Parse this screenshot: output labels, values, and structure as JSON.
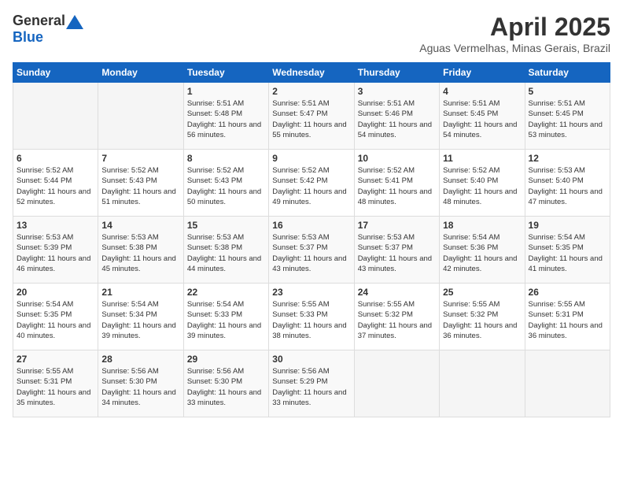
{
  "header": {
    "logo_general": "General",
    "logo_blue": "Blue",
    "title": "April 2025",
    "subtitle": "Aguas Vermelhas, Minas Gerais, Brazil"
  },
  "days_of_week": [
    "Sunday",
    "Monday",
    "Tuesday",
    "Wednesday",
    "Thursday",
    "Friday",
    "Saturday"
  ],
  "weeks": [
    [
      {
        "day": "",
        "info": ""
      },
      {
        "day": "",
        "info": ""
      },
      {
        "day": "1",
        "info": "Sunrise: 5:51 AM\nSunset: 5:48 PM\nDaylight: 11 hours and 56 minutes."
      },
      {
        "day": "2",
        "info": "Sunrise: 5:51 AM\nSunset: 5:47 PM\nDaylight: 11 hours and 55 minutes."
      },
      {
        "day": "3",
        "info": "Sunrise: 5:51 AM\nSunset: 5:46 PM\nDaylight: 11 hours and 54 minutes."
      },
      {
        "day": "4",
        "info": "Sunrise: 5:51 AM\nSunset: 5:45 PM\nDaylight: 11 hours and 54 minutes."
      },
      {
        "day": "5",
        "info": "Sunrise: 5:51 AM\nSunset: 5:45 PM\nDaylight: 11 hours and 53 minutes."
      }
    ],
    [
      {
        "day": "6",
        "info": "Sunrise: 5:52 AM\nSunset: 5:44 PM\nDaylight: 11 hours and 52 minutes."
      },
      {
        "day": "7",
        "info": "Sunrise: 5:52 AM\nSunset: 5:43 PM\nDaylight: 11 hours and 51 minutes."
      },
      {
        "day": "8",
        "info": "Sunrise: 5:52 AM\nSunset: 5:43 PM\nDaylight: 11 hours and 50 minutes."
      },
      {
        "day": "9",
        "info": "Sunrise: 5:52 AM\nSunset: 5:42 PM\nDaylight: 11 hours and 49 minutes."
      },
      {
        "day": "10",
        "info": "Sunrise: 5:52 AM\nSunset: 5:41 PM\nDaylight: 11 hours and 48 minutes."
      },
      {
        "day": "11",
        "info": "Sunrise: 5:52 AM\nSunset: 5:40 PM\nDaylight: 11 hours and 48 minutes."
      },
      {
        "day": "12",
        "info": "Sunrise: 5:53 AM\nSunset: 5:40 PM\nDaylight: 11 hours and 47 minutes."
      }
    ],
    [
      {
        "day": "13",
        "info": "Sunrise: 5:53 AM\nSunset: 5:39 PM\nDaylight: 11 hours and 46 minutes."
      },
      {
        "day": "14",
        "info": "Sunrise: 5:53 AM\nSunset: 5:38 PM\nDaylight: 11 hours and 45 minutes."
      },
      {
        "day": "15",
        "info": "Sunrise: 5:53 AM\nSunset: 5:38 PM\nDaylight: 11 hours and 44 minutes."
      },
      {
        "day": "16",
        "info": "Sunrise: 5:53 AM\nSunset: 5:37 PM\nDaylight: 11 hours and 43 minutes."
      },
      {
        "day": "17",
        "info": "Sunrise: 5:53 AM\nSunset: 5:37 PM\nDaylight: 11 hours and 43 minutes."
      },
      {
        "day": "18",
        "info": "Sunrise: 5:54 AM\nSunset: 5:36 PM\nDaylight: 11 hours and 42 minutes."
      },
      {
        "day": "19",
        "info": "Sunrise: 5:54 AM\nSunset: 5:35 PM\nDaylight: 11 hours and 41 minutes."
      }
    ],
    [
      {
        "day": "20",
        "info": "Sunrise: 5:54 AM\nSunset: 5:35 PM\nDaylight: 11 hours and 40 minutes."
      },
      {
        "day": "21",
        "info": "Sunrise: 5:54 AM\nSunset: 5:34 PM\nDaylight: 11 hours and 39 minutes."
      },
      {
        "day": "22",
        "info": "Sunrise: 5:54 AM\nSunset: 5:33 PM\nDaylight: 11 hours and 39 minutes."
      },
      {
        "day": "23",
        "info": "Sunrise: 5:55 AM\nSunset: 5:33 PM\nDaylight: 11 hours and 38 minutes."
      },
      {
        "day": "24",
        "info": "Sunrise: 5:55 AM\nSunset: 5:32 PM\nDaylight: 11 hours and 37 minutes."
      },
      {
        "day": "25",
        "info": "Sunrise: 5:55 AM\nSunset: 5:32 PM\nDaylight: 11 hours and 36 minutes."
      },
      {
        "day": "26",
        "info": "Sunrise: 5:55 AM\nSunset: 5:31 PM\nDaylight: 11 hours and 36 minutes."
      }
    ],
    [
      {
        "day": "27",
        "info": "Sunrise: 5:55 AM\nSunset: 5:31 PM\nDaylight: 11 hours and 35 minutes."
      },
      {
        "day": "28",
        "info": "Sunrise: 5:56 AM\nSunset: 5:30 PM\nDaylight: 11 hours and 34 minutes."
      },
      {
        "day": "29",
        "info": "Sunrise: 5:56 AM\nSunset: 5:30 PM\nDaylight: 11 hours and 33 minutes."
      },
      {
        "day": "30",
        "info": "Sunrise: 5:56 AM\nSunset: 5:29 PM\nDaylight: 11 hours and 33 minutes."
      },
      {
        "day": "",
        "info": ""
      },
      {
        "day": "",
        "info": ""
      },
      {
        "day": "",
        "info": ""
      }
    ]
  ]
}
